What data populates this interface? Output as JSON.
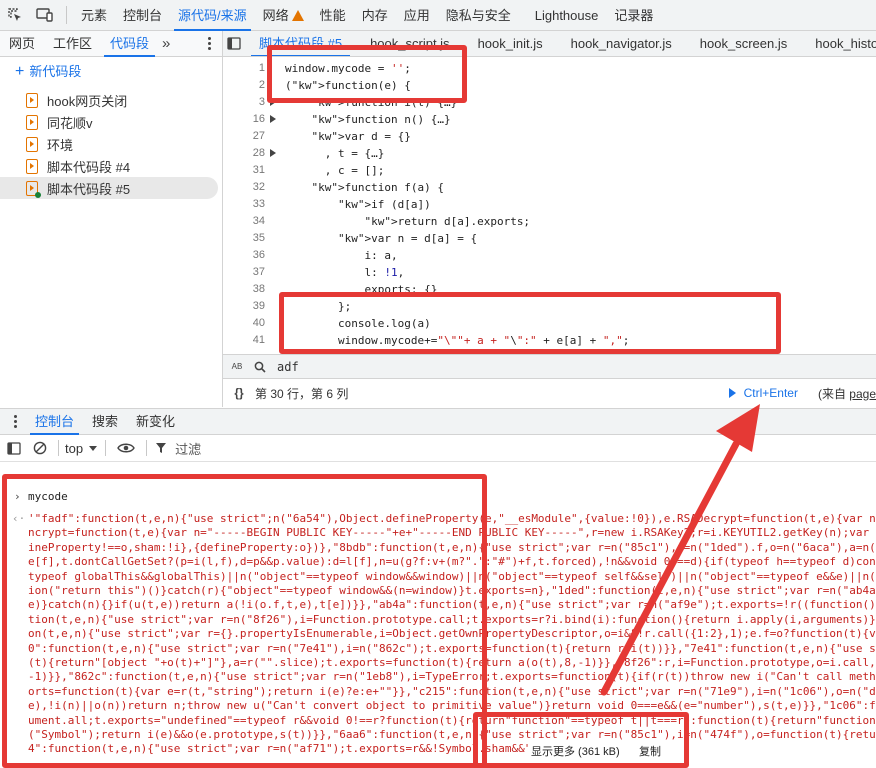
{
  "top_tabs": [
    "元素",
    "控制台",
    "源代码/来源",
    "网络",
    "性能",
    "内存",
    "应用",
    "隐私与安全",
    "Lighthouse",
    "记录器"
  ],
  "top_tabs_active": "源代码/来源",
  "top_tabs_warning": "网络",
  "navigator": {
    "tabs": [
      "网页",
      "工作区",
      "代码段"
    ],
    "active_tab": "代码段",
    "more_glyph": "»",
    "new_snippet": "新代码段",
    "snippets": [
      "hook网页关闭",
      "同花顺v",
      "环境",
      "脚本代码段 #4",
      "脚本代码段 #5"
    ],
    "selected": "脚本代码段 #5"
  },
  "editor": {
    "tabs": [
      "脚本代码段 #5",
      "hook_script.js",
      "hook_init.js",
      "hook_navigator.js",
      "hook_screen.js",
      "hook_histo"
    ],
    "active_tab": "脚本代码段 #5",
    "gutter": [
      {
        "n": "1",
        "fold": false
      },
      {
        "n": "2",
        "fold": false
      },
      {
        "n": "3",
        "fold": true
      },
      {
        "n": "16",
        "fold": true
      },
      {
        "n": "27",
        "fold": false
      },
      {
        "n": "28",
        "fold": true
      },
      {
        "n": "31",
        "fold": false
      },
      {
        "n": "32",
        "fold": false
      },
      {
        "n": "33",
        "fold": false
      },
      {
        "n": "34",
        "fold": false
      },
      {
        "n": "35",
        "fold": false
      },
      {
        "n": "36",
        "fold": false
      },
      {
        "n": "37",
        "fold": false
      },
      {
        "n": "38",
        "fold": false
      },
      {
        "n": "39",
        "fold": false
      },
      {
        "n": "40",
        "fold": false
      },
      {
        "n": "41",
        "fold": false
      }
    ],
    "code_lines": [
      "window.mycode = '';",
      "(function(e) {",
      "    function i(t) {…}",
      "    function n() {…}",
      "    var d = {}",
      "      , t = {…}",
      "      , c = [];",
      "    function f(a) {",
      "        if (d[a])",
      "            return d[a].exports;",
      "        var n = d[a] = {",
      "            i: a,",
      "            l: !1,",
      "            exports: {}",
      "        };",
      "        console.log(a)",
      "        window.mycode+=\"\\\"\"+ a + \"\\\":\" + e[a] + \",\";"
    ],
    "search_value": "adf",
    "search_left_glyph": "AB",
    "status_position": "第 30 行，第 6 列",
    "run_label": "Ctrl+Enter",
    "status_right": "(来自",
    "status_right_link": "page"
  },
  "drawer": {
    "tabs": [
      "控制台",
      "搜索",
      "新变化"
    ],
    "active_tab": "控制台",
    "context": "top",
    "filter_label": "过滤"
  },
  "console": {
    "input": "mycode",
    "output_lines": [
      "'\"fadf\":function(t,e,n){\"use strict\";n(\"6a54\"),Object.defineProperty(e,\"__esModule\",{value:!0}),e.RSADecrypt=function(t,e){var n=\"-----BEGIN P",
      "ncrypt=function(t,e){var n=\"-----BEGIN PUBLIC KEY-----\"+e+\"-----END PUBLIC KEY-----\",r=new i.RSAKey2;r=i.KEYUTIL2.getKey(n);var s=r.encrypt(t);",
      "ineProperty!==o,sham:!i},{defineProperty:o})},\"8bdb\":function(t,e,n){\"use strict\";var r=n(\"85c1\"),i=n(\"1ded\").f,o=n(\"6aca\"),a=n(\"81a9\"),s=n(\"c",
      "e[f],t.dontCallGetSet?(p=i(l,f),d=p&&p.value):d=l[f],n=u(g?f:v+(m?\".\":\"#\")+f,t.forced),!n&&void 0!==d){if(typeof h==typeof d)continue;c(h,d)}",
      "typeof globalThis&&globalThis)||n(\"object\"==typeof window&&window)||n(\"object\"==typeof self&&self)||n(\"object\"==typeof e&&e)||n(\"object\"==type",
      "ion(\"return this\")()}catch(r){\"object\"==typeof window&&(n=window)}t.exports=n},\"1ded\":function(t,e,n){\"use strict\";var r=n(\"ab4a\"),i=n(\"71e9\"",
      "e)}catch(n){}if(u(t,e))return a(!i(o.f,t,e),t[e])}},\"ab4a\":function(t,e,n){\"use strict\";var r=n(\"af9e\");t.exports=!r((function(){return 7!==Ob",
      "tion(t,e,n){\"use strict\";var r=n(\"8f26\"),i=Function.prototype.call;t.exports=r?i.bind(i):function(){return i.apply(i,arguments)}},\"8f26\":funct",
      "on(t,e,n){\"use strict\";var r={}.propertyIsEnumerable,i=Object.getOwnPropertyDescriptor,o=i&&!r.call({1:2},1);e.f=o?function(t){var e=i(this,t",
      "0\":function(t,e,n){\"use strict\";var r=n(\"7e41\"),i=n(\"862c\");t.exports=function(t){return r(i(t))}},\"7e41\":function(t,e,n){\"use strict\";var r=n",
      "(t){return\"[object \"+o(t)+\"]\"},a=r(\"\".slice);t.exports=function(t){return a(o(t),8,-1)}},\"8f26\":r,i=Function.prototype,o=i.call,a=r&&i.bind.bind(o,o);t.exports=r?a:function(t){retur",
      "-1)}},\"862c\":function(t,e,n){\"use strict\";var r=n(\"1eb8\"),i=TypeError;t.exports=function(t){if(r(t))throw new i(\"Can't call method on \"+t);ret",
      "orts=function(t){var e=r(t,\"string\");return i(e)?e:e+\"\"}},\"c215\":function(t,e,n){\"use strict\";var r=n(\"71e9\"),i=n(\"1c06\"),o=n(\"ddd3\"),a=n(\"60b",
      "e),!i(n)||o(n))return n;throw new u(\"Can't convert object to primitive value\")}return void 0===e&&(e=\"number\"),s(t,e)}},\"1c06\":function(t,e,n",
      "ument.all;t.exports=\"undefined\"==typeof r&&void 0!==r?function(t){return\"function\"==typeof t||t===r}:function(t){return\"function\"==typeof t}},",
      "(\"Symbol\");return i(e)&&o(e.prototype,s(t))}},\"6aa6\":function(t,e,n){\"use strict\";var r=n(\"85c1\"),i=n(\"474f\"),o=function(t){return i(t)?t:void",
      "4\":function(t,e,n){\"use strict\";var r=n(\"af71\");t.exports=r&&!Symbol.sham&&\"symbol\""
    ],
    "show_more": "显示更多 (361 kB)",
    "copy": "复制"
  }
}
